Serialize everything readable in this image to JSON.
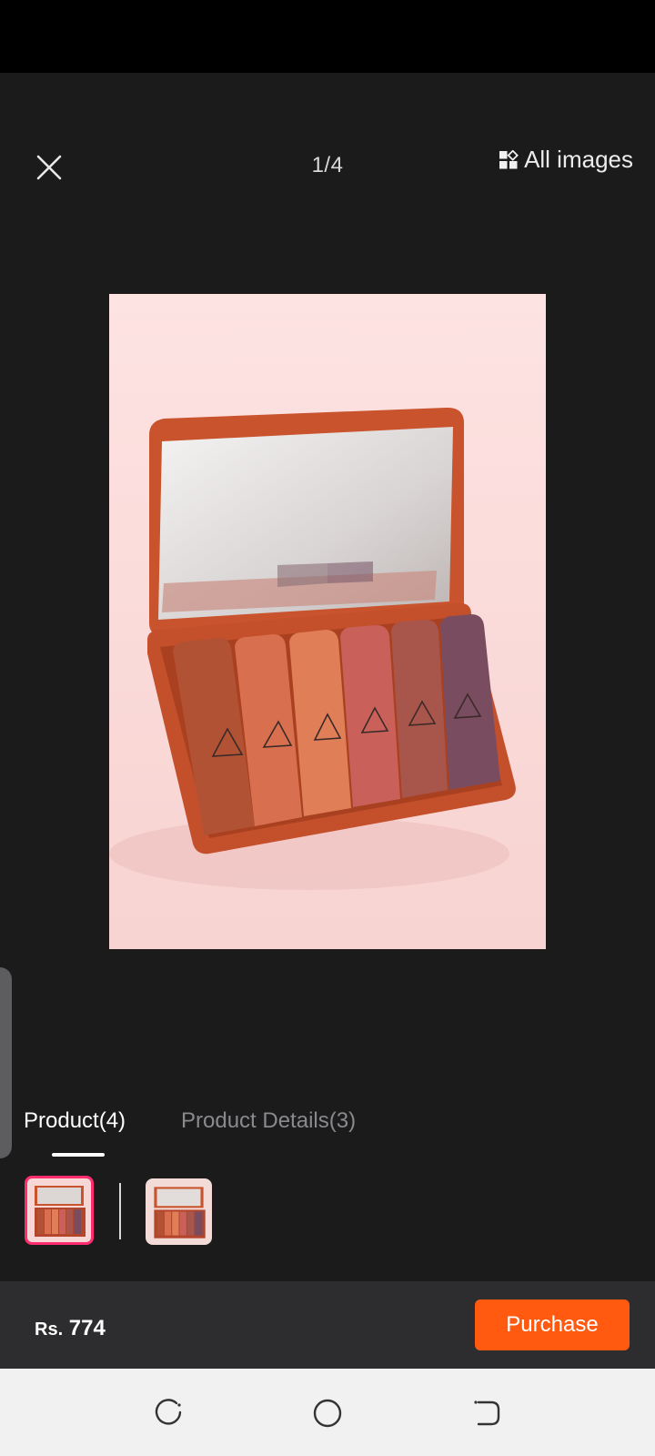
{
  "viewer": {
    "counter": "1/4",
    "all_images_label": "All images",
    "close_icon": "close-icon",
    "grid_icon": "grid-icon"
  },
  "tabs": {
    "product": "Product(4)",
    "details": "Product Details(3)",
    "active": "product"
  },
  "thumbnails": {
    "selected_index": 0,
    "accent": "#ff2d6f"
  },
  "footer": {
    "price_currency": "Rs.",
    "price_value": "774",
    "purchase_label": "Purchase",
    "accent": "#ff5a10"
  },
  "navbar": {
    "icons": [
      "recent-apps-icon",
      "home-icon",
      "back-icon"
    ]
  }
}
